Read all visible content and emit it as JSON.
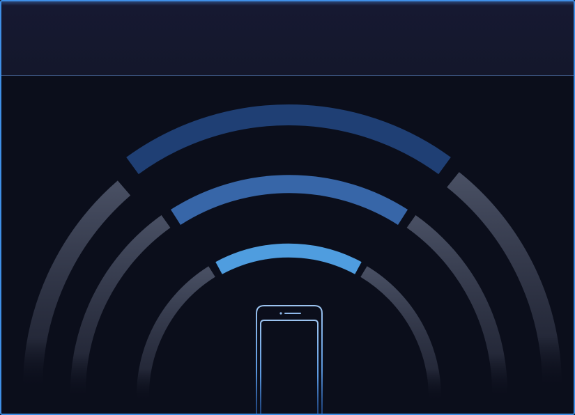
{
  "window": {
    "title": ""
  },
  "signal": {
    "device_icon": "smartphone-icon",
    "wave_icon": "wireless-signal-icon",
    "arcs_total": 3,
    "arcs_active": 3,
    "colors": {
      "accent": "#3f8fe6",
      "arc_inner": "#4f9ddf",
      "arc_middle": "#3766a8",
      "arc_outer": "#1f3f74",
      "arc_track": "#4b5266",
      "background": "#0b0e1b",
      "header": "#161932"
    }
  }
}
